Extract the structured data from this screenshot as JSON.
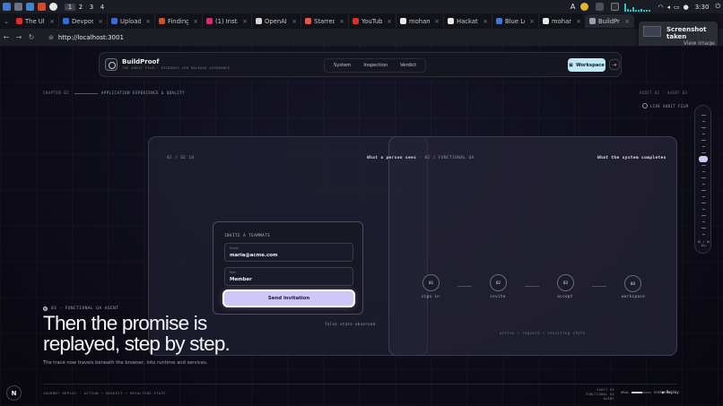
{
  "os": {
    "workspaces": [
      "1",
      "2",
      "3",
      "4"
    ],
    "active_workspace": "1",
    "clock": "3:30"
  },
  "browser": {
    "tabs": [
      {
        "title": "The Ultim",
        "color": "#e32b2b"
      },
      {
        "title": "Devpost",
        "color": "#3b6bd8"
      },
      {
        "title": "Uploadi",
        "color": "#3b6bd8"
      },
      {
        "title": "Finding",
        "color": "#c9532a"
      },
      {
        "title": "(1) Instag",
        "color": "#d6306f"
      },
      {
        "title": "OpenAI",
        "color": "#d8d8d8"
      },
      {
        "title": "Starred",
        "color": "#e05a4f"
      },
      {
        "title": "YouTube",
        "color": "#e32b2b"
      },
      {
        "title": "moham",
        "color": "#e8e8e8"
      },
      {
        "title": "Hackath",
        "color": "#e8e8e8"
      },
      {
        "title": "Blue Lo",
        "color": "#3c7ad8"
      },
      {
        "title": "moham",
        "color": "#e8e8e8"
      },
      {
        "title": "BuildPr",
        "color": "#9aa0ad"
      }
    ],
    "active_tab_index": 12,
    "url": "http://localhost:3001"
  },
  "notification": {
    "title": "Screenshot taken",
    "action": "View image"
  },
  "nav": {
    "brand": "BuildProof",
    "tagline": "THE AUDIT FILM · EVIDENCE-LED RELEASE ASSURANCE",
    "links": [
      "System",
      "Inspection",
      "Verdict"
    ],
    "workspace_button": "Workspace",
    "exit_icon": "exit-icon"
  },
  "chapter": {
    "label": "CHAPTER 02",
    "section": "APPLICATION EXPERIENCE & QUALITY",
    "audit": "AUDIT 02 · AGENT 03",
    "live_link": "LIVE AUDIT FILM"
  },
  "stage": {
    "id": "02 / SE 10",
    "human_label": "What a person sees",
    "human_suffix": "02 / FUNCTIONAL QA",
    "system_label": "What the system completes",
    "invite_card": {
      "title": "INVITE A TEAMMATE",
      "email_label": "Email",
      "email_value": "maria@acme.com",
      "role_label": "Role",
      "role_value": "Member",
      "submit": "Send invitation"
    },
    "false_state": "false state observed",
    "steps": [
      {
        "num": "01",
        "label": "sign in"
      },
      {
        "num": "02",
        "label": "invite"
      },
      {
        "num": "03",
        "label": "accept"
      },
      {
        "num": "04",
        "label": "workspace"
      }
    ],
    "flow_caption": "action → request → resulting state"
  },
  "hero": {
    "agent_tag": "03 · FUNCTIONAL QA AGENT",
    "headline": "Then the promise is replayed, step by step.",
    "subline": "The trace now travels beneath the browser, into runtime and services."
  },
  "footer": {
    "left": "JOURNEY REPLAY · ACTION → REQUEST → RESULTING STATE",
    "audit_line1": "AUDIT 03",
    "audit_line2": "FUNCTIONAL QA AGENT",
    "progress_label": "ORAL",
    "progress_value": "OVERVIEW",
    "progress_fraction": 0.55,
    "play": "Replay"
  },
  "scrubber": {
    "counter_line1": "01 / 10",
    "counter_line2": "ALL"
  },
  "badge": "N"
}
